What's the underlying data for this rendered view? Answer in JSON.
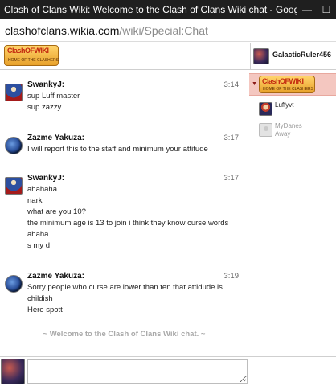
{
  "window": {
    "title": "Clash of Clans Wiki: Welcome to the Clash of Clans Wiki chat - Google ...",
    "minimize": "—",
    "maximize": "☐"
  },
  "url": {
    "host": "clashofclans.wikia.com",
    "path": "/wiki/Special:Chat"
  },
  "header": {
    "logo_text": "ClashOFWIKI",
    "logo_sub": "HOME OF THE CLASHERS",
    "current_user": "GalacticRuler456"
  },
  "messages": [
    {
      "user": "SwankyJ:",
      "time": "3:14",
      "lines": [
        "sup Luff master",
        "sup zazzy"
      ]
    },
    {
      "user": "Zazme Yakuza:",
      "time": "3:17",
      "lines": [
        "I will report this to the staff and minimum your attitude"
      ]
    },
    {
      "user": "SwankyJ:",
      "time": "3:17",
      "lines": [
        "ahahaha",
        "nark",
        "what are you 10?",
        "the minimum age is 13 to join i think they know curse words",
        "ahaha",
        "s my d"
      ]
    },
    {
      "user": "Zazme Yakuza:",
      "time": "3:19",
      "lines": [
        "Sorry people who curse are lower than ten that attidude is",
        "childish",
        "Here spott"
      ]
    }
  ],
  "welcome": "~ Welcome to the Clash of Clans Wiki chat. ~",
  "sidebar": {
    "room_arrow": "▼",
    "members": [
      {
        "name": "Luffyvt",
        "status": ""
      },
      {
        "name": "MyDanes",
        "status": "Away"
      }
    ]
  },
  "input": {
    "value": ""
  },
  "colors": {
    "titlebar": "#1f1f1f",
    "room_highlight": "#f4c7c0",
    "welcome_text": "#a9a9a9"
  }
}
